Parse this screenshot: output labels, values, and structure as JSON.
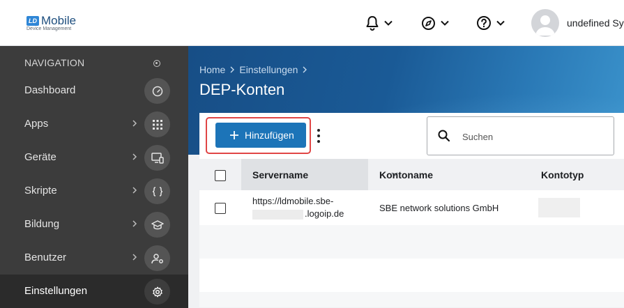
{
  "app": {
    "logo_badge": "LD",
    "logo_title": "Mobile",
    "logo_subtitle": "Device Management"
  },
  "topbar": {
    "icons": [
      "bell-icon",
      "compass-icon",
      "help-icon"
    ],
    "user_name": "undefined Sys"
  },
  "sidebar": {
    "heading": "NAVIGATION",
    "items": [
      {
        "label": "Dashboard",
        "icon": "speedometer-icon",
        "has_arrow": false
      },
      {
        "label": "Apps",
        "icon": "grid-icon",
        "has_arrow": true
      },
      {
        "label": "Geräte",
        "icon": "devices-icon",
        "has_arrow": true
      },
      {
        "label": "Skripte",
        "icon": "braces-icon",
        "has_arrow": true
      },
      {
        "label": "Bildung",
        "icon": "graduation-cap-icon",
        "has_arrow": true
      },
      {
        "label": "Benutzer",
        "icon": "user-gear-icon",
        "has_arrow": true
      },
      {
        "label": "Einstellungen",
        "icon": "gear-icon",
        "has_arrow": false,
        "active": true
      }
    ]
  },
  "breadcrumb": [
    "Home",
    "Einstellungen"
  ],
  "page_title": "DEP-Konten",
  "toolbar": {
    "add_label": "Hinzufügen",
    "search_placeholder": "Suchen"
  },
  "table": {
    "columns": [
      "Servername",
      "Kontoname",
      "Kontotyp"
    ],
    "rows": [
      {
        "servername_line1": "https://ldmobile.sbe-",
        "servername_line2": ".logoip.de",
        "kontoname": "SBE network solutions GmbH"
      }
    ]
  },
  "colors": {
    "accent": "#1c74b8",
    "sidebar_bg": "#3c3c3c",
    "highlight": "#e04545"
  }
}
